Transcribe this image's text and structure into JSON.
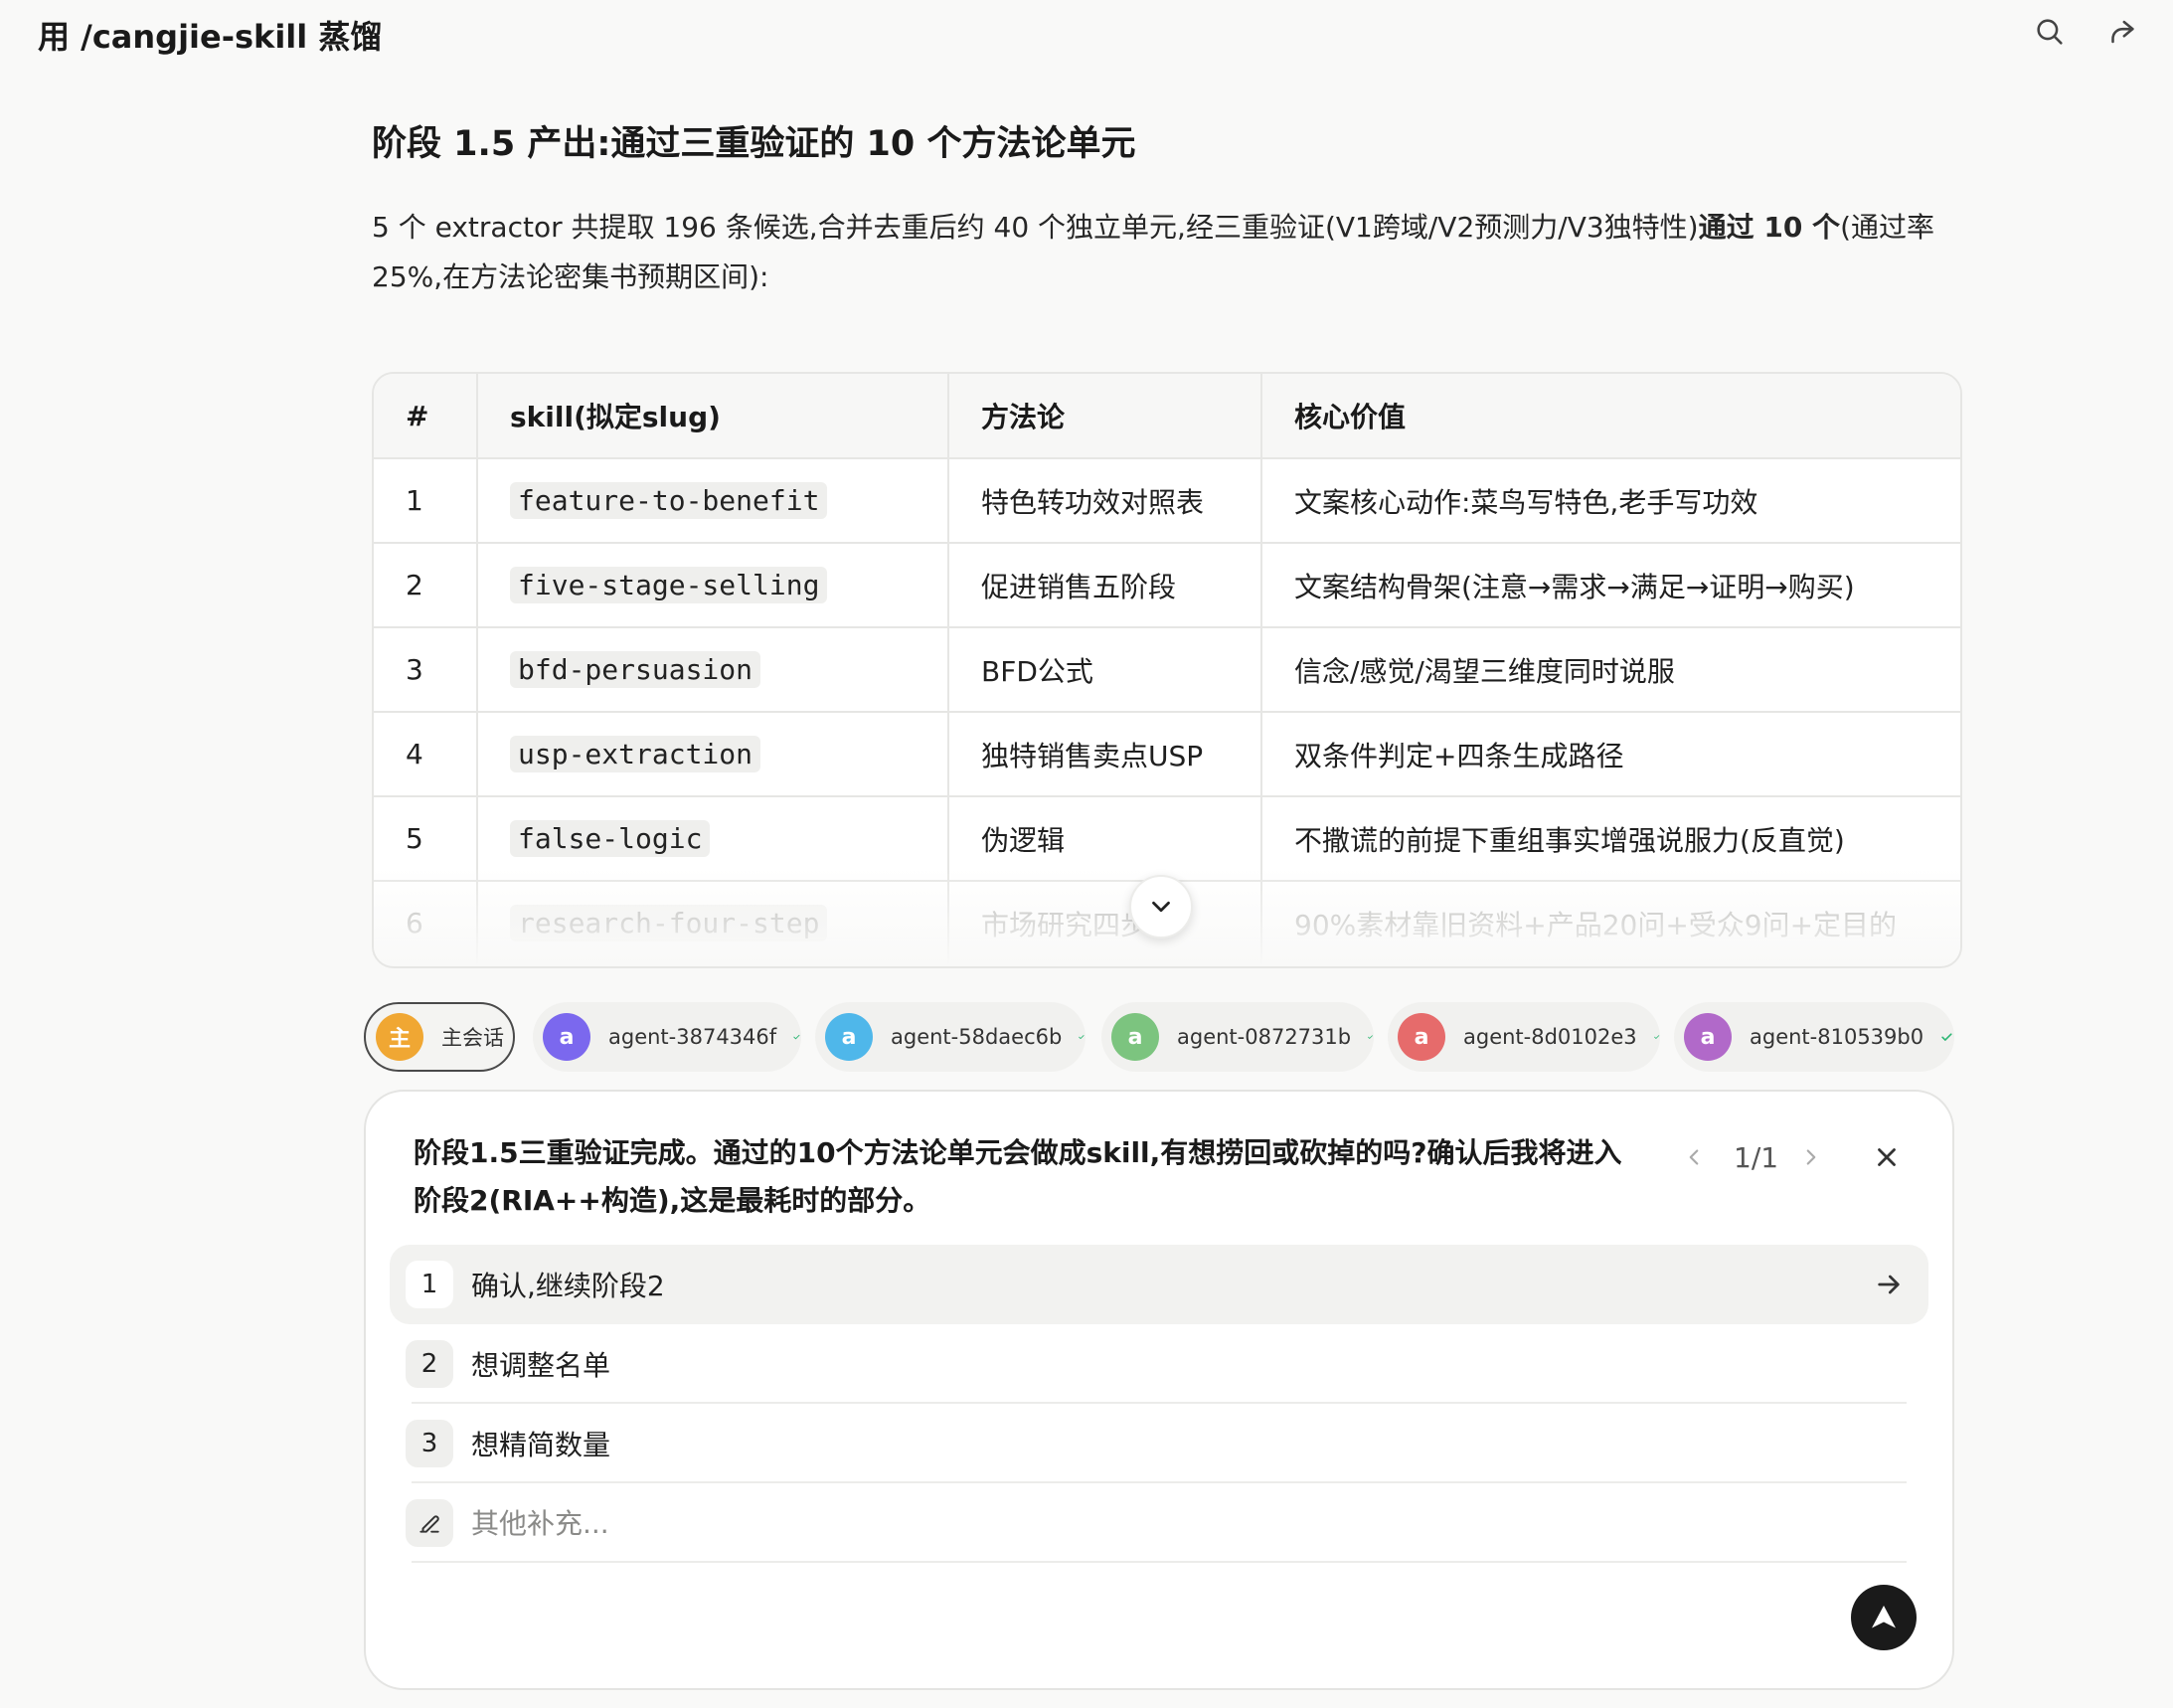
{
  "header": {
    "title": "用 /cangjie-skill 蒸馏",
    "search_icon": "search-icon",
    "share_icon": "share-icon"
  },
  "section": {
    "heading": "阶段 1.5 产出:通过三重验证的 10 个方法论单元",
    "para_prefix": "5 个 extractor 共提取 196 条候选,合并去重后约 40 个独立单元,经三重验证(V1跨域/V2预测力/V3独特性)",
    "para_bold": "通过 10 个",
    "para_suffix": "(通过率 25%,在方法论密集书预期区间):"
  },
  "table": {
    "headers": [
      "#",
      "skill(拟定slug)",
      "方法论",
      "核心价值"
    ],
    "rows": [
      {
        "num": "1",
        "slug": "feature-to-benefit",
        "method": "特色转功效对照表",
        "value": "文案核心动作:菜鸟写特色,老手写功效"
      },
      {
        "num": "2",
        "slug": "five-stage-selling",
        "method": "促进销售五阶段",
        "value": "文案结构骨架(注意→需求→满足→证明→购买)"
      },
      {
        "num": "3",
        "slug": "bfd-persuasion",
        "method": "BFD公式",
        "value": "信念/感觉/渴望三维度同时说服"
      },
      {
        "num": "4",
        "slug": "usp-extraction",
        "method": "独特销售卖点USP",
        "value": "双条件判定+四条生成路径"
      },
      {
        "num": "5",
        "slug": "false-logic",
        "method": "伪逻辑",
        "value": "不撒谎的前提下重组事实增强说服力(反直觉)"
      },
      {
        "num": "6",
        "slug": "research-four-step",
        "method": "市场研究四步",
        "value": "90%素材靠旧资料+产品20问+受众9问+定目的"
      }
    ]
  },
  "agents": [
    {
      "avatar": "主",
      "label": "主会话",
      "color": "#f0a733",
      "main": true
    },
    {
      "avatar": "a",
      "label": "agent-3874346f",
      "color": "#7b68ee",
      "main": false
    },
    {
      "avatar": "a",
      "label": "agent-58daec6b",
      "color": "#4fb7ea",
      "main": false
    },
    {
      "avatar": "a",
      "label": "agent-0872731b",
      "color": "#7cc47f",
      "main": false
    },
    {
      "avatar": "a",
      "label": "agent-8d0102e3",
      "color": "#e66b6b",
      "main": false
    },
    {
      "avatar": "a",
      "label": "agent-810539b0",
      "color": "#b169c9",
      "main": false
    }
  ],
  "question_card": {
    "question": "阶段1.5三重验证完成。通过的10个方法论单元会做成skill,有想捞回或砍掉的吗?确认后我将进入阶段2(RIA++构造),这是最耗时的部分。",
    "pager": "1/1",
    "options": [
      {
        "num": "1",
        "label": "确认,继续阶段2"
      },
      {
        "num": "2",
        "label": "想调整名单"
      },
      {
        "num": "3",
        "label": "想精简数量"
      }
    ],
    "other_placeholder": "其他补充..."
  },
  "colors": {
    "check": "#2bb673",
    "send_button": "#1a1a1a"
  }
}
